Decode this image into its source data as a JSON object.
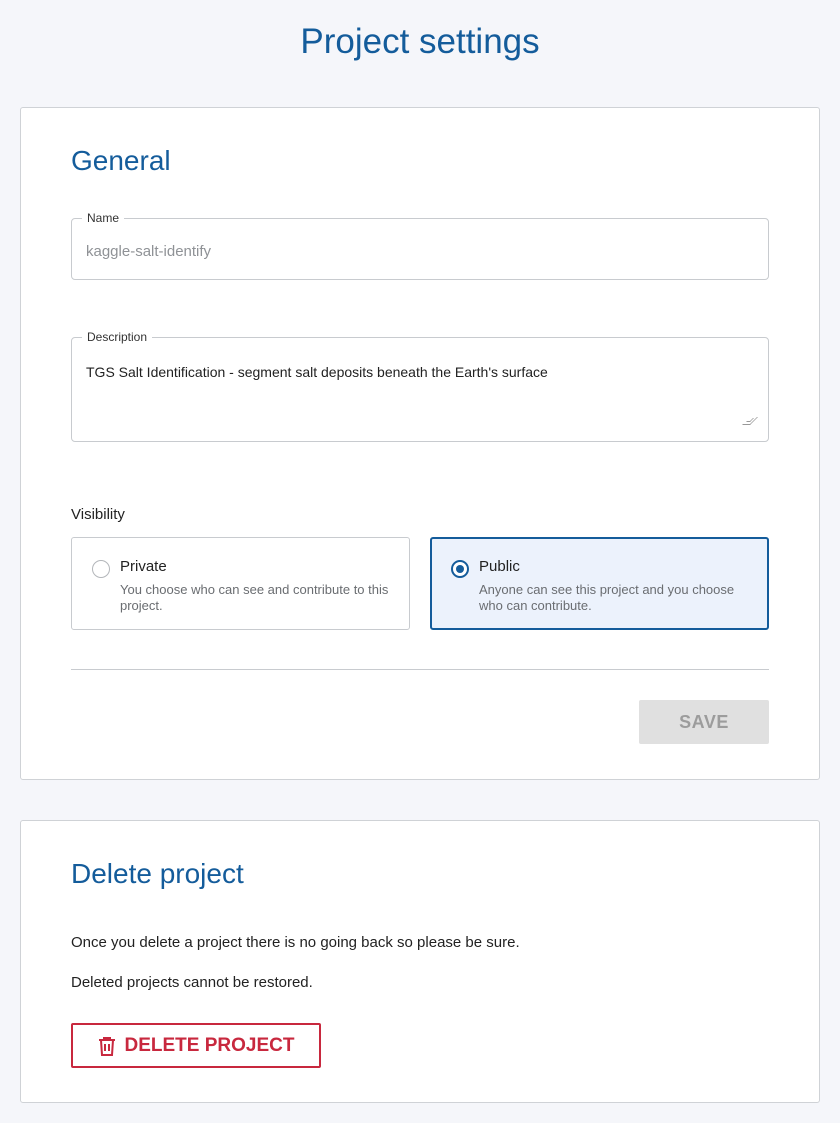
{
  "page": {
    "title": "Project settings"
  },
  "general": {
    "title": "General",
    "name_label": "Name",
    "name_value": "kaggle-salt-identify",
    "description_label": "Description",
    "description_value": "TGS Salt Identification - segment salt deposits beneath the Earth's surface",
    "visibility_label": "Visibility",
    "visibility_options": [
      {
        "title": "Private",
        "description": "You choose who can see and contribute to this project.",
        "selected": false
      },
      {
        "title": "Public",
        "description": "Anyone can see this project and you choose who can contribute.",
        "selected": true
      }
    ],
    "save_label": "SAVE"
  },
  "delete": {
    "title": "Delete project",
    "text_1": "Once you delete a project there is no going back so please be sure.",
    "text_2": "Deleted projects cannot be restored.",
    "button_label": "DELETE PROJECT",
    "button_icon": "trash-icon"
  },
  "colors": {
    "accent": "#145c9b",
    "danger": "#c8283e",
    "background": "#f5f6fa",
    "selected_bg": "#ecf2fc"
  }
}
